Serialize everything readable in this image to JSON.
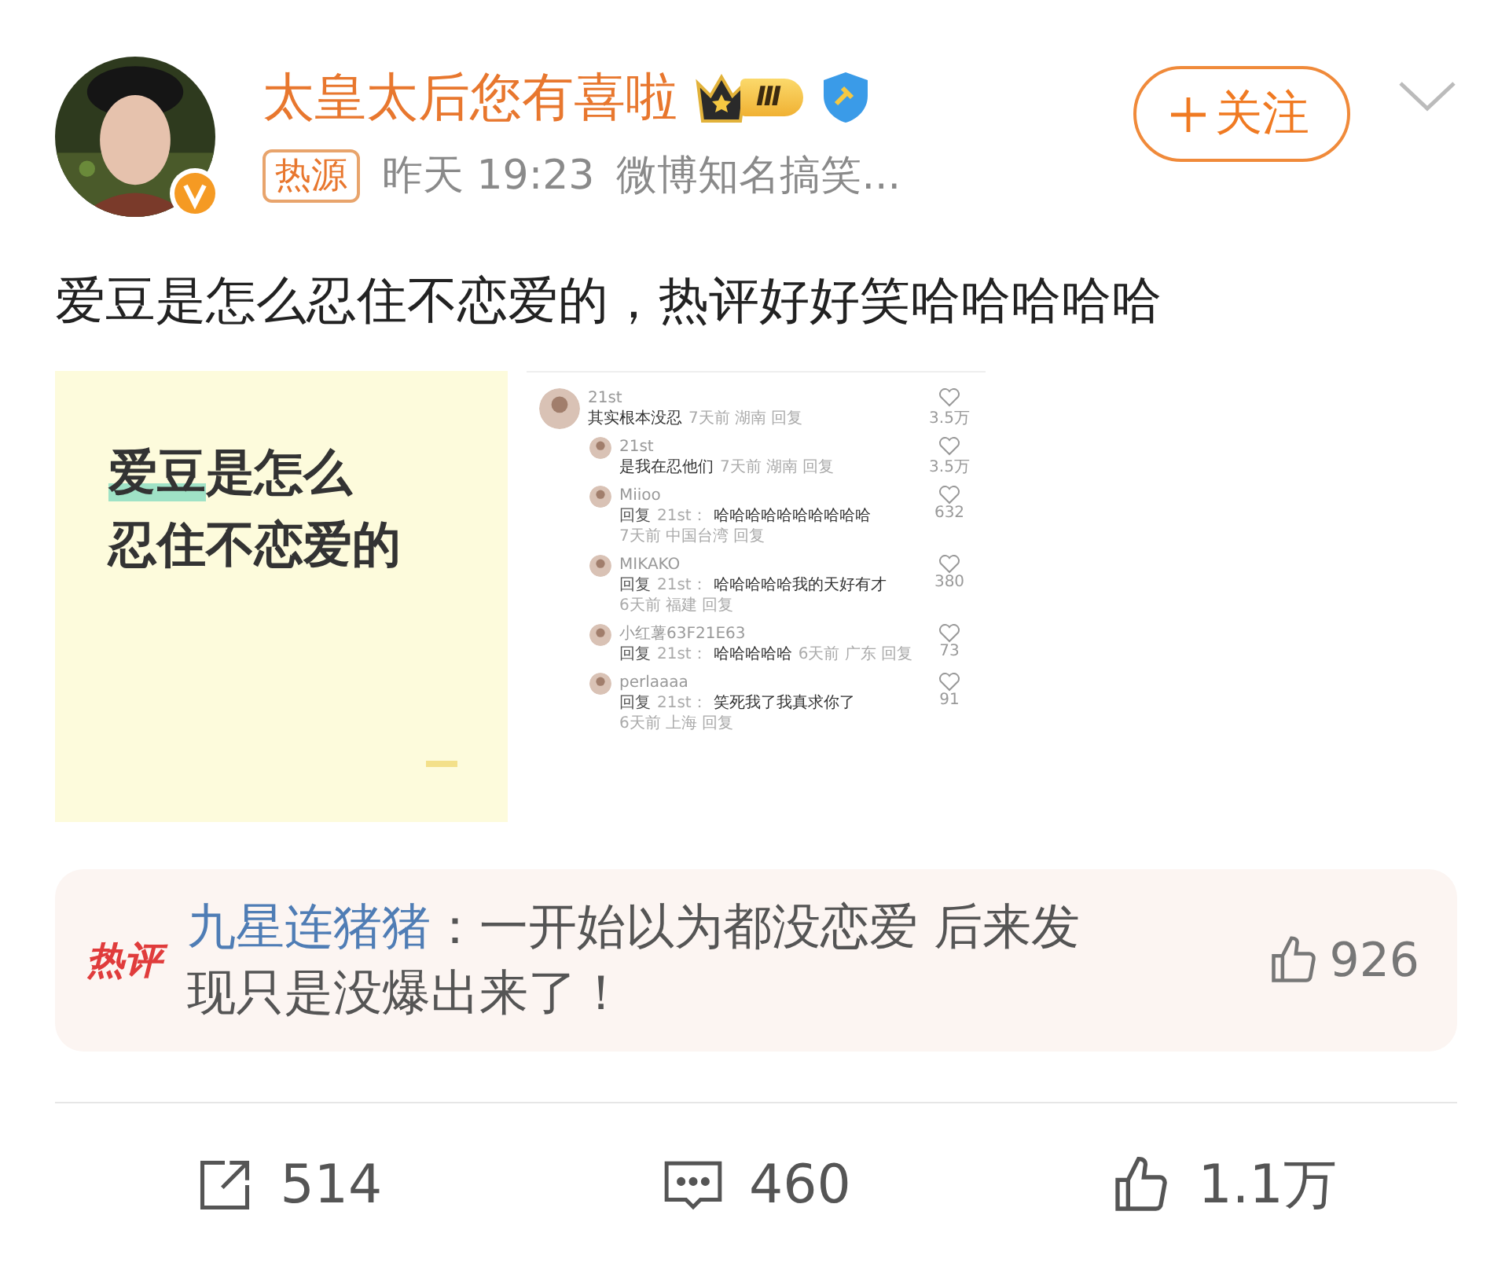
{
  "author": {
    "name": "太皇太后您有喜啦",
    "level_badge": "Ⅲ",
    "tag": "热源",
    "time": "昨天 19:23",
    "source": "微博知名搞笑...",
    "follow": "关注"
  },
  "post": {
    "text": "爱豆是怎么忍住不恋爱的，热评好好笑哈哈哈哈哈"
  },
  "images": [
    {
      "kind": "card",
      "highlight": "爱豆",
      "line_1_rest": "是怎么",
      "line_2": "忍住不恋爱的"
    },
    {
      "kind": "comments",
      "comments": [
        {
          "name": "21st",
          "text": "其实根本没忍",
          "meta": "7天前 湖南 回复",
          "meta_inline": true,
          "likes": "3.5万",
          "children": [
            {
              "name": "21st",
              "text": "是我在忍他们",
              "meta": "7天前 湖南 回复",
              "meta_inline": true,
              "likes": "3.5万"
            },
            {
              "name": "Miioo",
              "reply_label": "回复",
              "reply_to": "21st：",
              "text": "哈哈哈哈哈哈哈哈哈哈",
              "meta": "7天前 中国台湾 回复",
              "meta_inline": false,
              "likes": "632"
            },
            {
              "name": "MIKAKO",
              "reply_label": "回复",
              "reply_to": "21st：",
              "text": "哈哈哈哈哈我的天好有才",
              "meta": "6天前 福建 回复",
              "meta_inline": false,
              "likes": "380"
            },
            {
              "name": "小红薯63F21E63",
              "reply_label": "回复",
              "reply_to": "21st：",
              "text": "哈哈哈哈哈",
              "meta": "6天前 广东 回复",
              "meta_inline": true,
              "likes": "73"
            },
            {
              "name": "perlaaaa",
              "reply_label": "回复",
              "reply_to": "21st：",
              "text": "笑死我了我真求你了",
              "meta": "6天前 上海 回复",
              "meta_inline": false,
              "likes": "91"
            }
          ]
        }
      ]
    }
  ],
  "hot_comment": {
    "label": "热评",
    "user": "九星连猪猪",
    "text": "：一开始以为都没恋爱 后来发现只是没爆出来了！",
    "likes": "926"
  },
  "actions": [
    {
      "kind": "share",
      "count": "514"
    },
    {
      "kind": "comment",
      "count": "460"
    },
    {
      "kind": "like",
      "count": "1.1万"
    }
  ]
}
